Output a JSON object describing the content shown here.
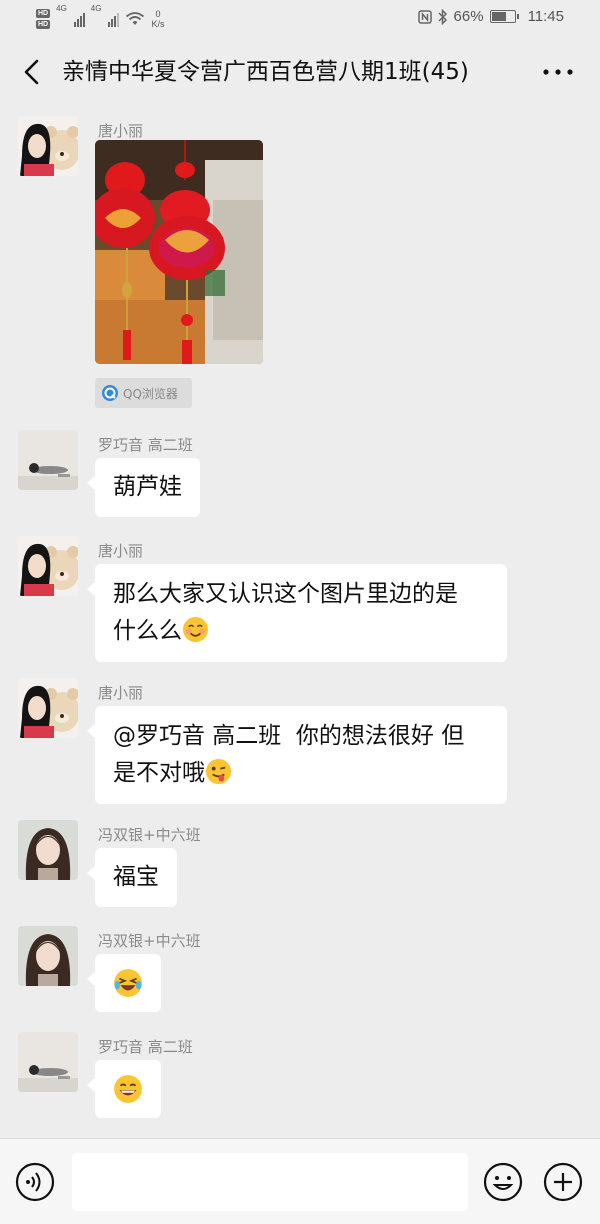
{
  "status_bar": {
    "hd_labels": [
      "HD",
      "HD"
    ],
    "net_labels": [
      "4G",
      "4G"
    ],
    "speed_value": "0",
    "speed_unit": "K/s",
    "battery": "66%",
    "battery_level": 0.66,
    "time": "11:45"
  },
  "header": {
    "title": "亲情中华夏令营广西百色营八期1班(45)"
  },
  "messages": [
    {
      "sender": "唐小丽",
      "type": "image",
      "source_label": "QQ浏览器"
    },
    {
      "sender": "罗巧音 高二班",
      "type": "text",
      "text": "葫芦娃"
    },
    {
      "sender": "唐小丽",
      "type": "text",
      "lines": [
        "那么大家又认识这个图片里边的是",
        "什么么"
      ],
      "emoji": "smiling-face"
    },
    {
      "sender": "唐小丽",
      "type": "text",
      "lines": [
        "@罗巧音 高二班  你的想法很好 但",
        "是不对哦"
      ],
      "emoji": "winking-tongue-face"
    },
    {
      "sender": "冯双银+中六班",
      "type": "text",
      "text": "福宝"
    },
    {
      "sender": "冯双银+中六班",
      "type": "emoji",
      "emoji": "rolling-laughing-face"
    },
    {
      "sender": "罗巧音 高二班",
      "type": "emoji",
      "emoji": "grinning-face"
    }
  ],
  "input_bar": {
    "voice_icon": "voice-icon",
    "emoji_icon": "emoji-icon",
    "plus_icon": "plus-icon"
  },
  "colors": {
    "background": "#ededed",
    "bubble": "#ffffff",
    "name": "#8a8a8a"
  }
}
